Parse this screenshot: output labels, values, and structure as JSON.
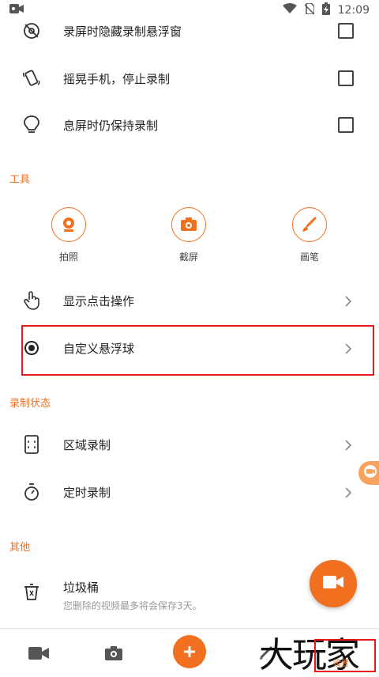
{
  "status": {
    "time": "12:09",
    "battery": "charging"
  },
  "settings": [
    {
      "label": "录屏时隐藏录制悬浮窗"
    },
    {
      "label": "摇晃手机，停止录制"
    },
    {
      "label": "息屏时仍保持录制"
    }
  ],
  "tools": {
    "title": "工具",
    "items": [
      {
        "label": "拍照"
      },
      {
        "label": "截屏"
      },
      {
        "label": "画笔"
      }
    ]
  },
  "nav_rows": [
    {
      "label": "显示点击操作"
    },
    {
      "label": "自定义悬浮球"
    }
  ],
  "rec_state": {
    "title": "录制状态",
    "items": [
      {
        "label": "区域录制"
      },
      {
        "label": "定时录制"
      }
    ]
  },
  "other": {
    "title": "其他",
    "trash_label": "垃圾桶",
    "trash_sub": "您删除的视频最多将会保存3天。"
  },
  "bottom": {
    "settings_label": "设置"
  },
  "watermark": "大玩家",
  "colors": {
    "accent": "#f07020",
    "highlight": "#e8191c"
  }
}
